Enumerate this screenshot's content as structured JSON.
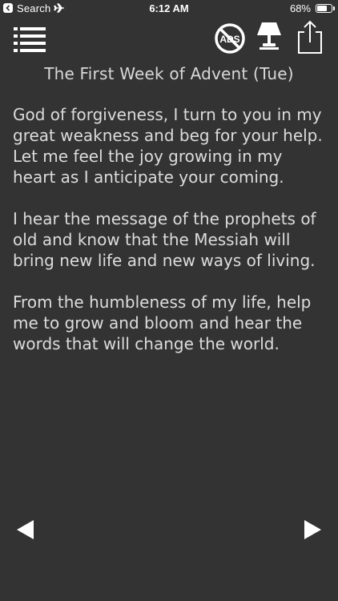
{
  "status_bar": {
    "carrier": "Search",
    "time": "6:12 AM",
    "battery_percent_text": "68%",
    "battery_level": 0.68,
    "icons": [
      "back-icon",
      "airplane-icon",
      "battery-icon"
    ]
  },
  "toolbar": {
    "icons": [
      "list-menu-icon",
      "no-ads-icon",
      "lamp-icon",
      "share-icon"
    ],
    "no_ads_label": "ADS"
  },
  "reading": {
    "title": "The First Week of Advent (Tue)",
    "paragraphs": [
      "God of forgiveness, I turn to you in my great weakness and beg for your help. Let me feel the joy growing in my heart as I anticipate your coming.",
      "I hear the message of the prophets of old and know that the Messiah will bring new life and new ways of living.",
      "From the humbleness of my life, help me to grow and bloom and hear the words that will change the world."
    ]
  },
  "navigation": {
    "icons": [
      "previous-arrow-icon",
      "next-arrow-icon"
    ]
  },
  "colors": {
    "background": "#333333",
    "text": "#dcdcdc",
    "icon": "#ffffff"
  }
}
